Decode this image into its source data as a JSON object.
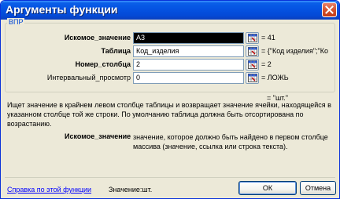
{
  "window": {
    "title": "Аргументы функции"
  },
  "function_group": "ВПР",
  "args": [
    {
      "label": "Искомое_значение",
      "value": "A3",
      "result": "= 41",
      "bold": true
    },
    {
      "label": "Таблица",
      "value": "Код_изделия",
      "result": "= {\"Код изделия\";\"Ко",
      "bold": true
    },
    {
      "label": "Номер_столбца",
      "value": "2",
      "result": "= 2",
      "bold": true
    },
    {
      "label": "Интервальный_просмотр",
      "value": "0",
      "result": "= ЛОЖЬ",
      "bold": false
    }
  ],
  "overall_result": "= \"шт.\"",
  "description": "Ищет значение в крайнем левом столбце таблицы и возвращает значение ячейки, находящейся в указанном столбце той же строки. По умолчанию таблица должна быть отсортирована по возрастанию.",
  "current_arg": {
    "name": "Искомое_значение",
    "description": "значение, которое должно быть найдено в первом столбце массива (значение, ссылка или строка текста)."
  },
  "footer": {
    "help_link": "Справка по этой функции",
    "value_label": "Значение:",
    "value": "шт.",
    "ok_label": "ОК",
    "cancel_label": "Отмена"
  }
}
